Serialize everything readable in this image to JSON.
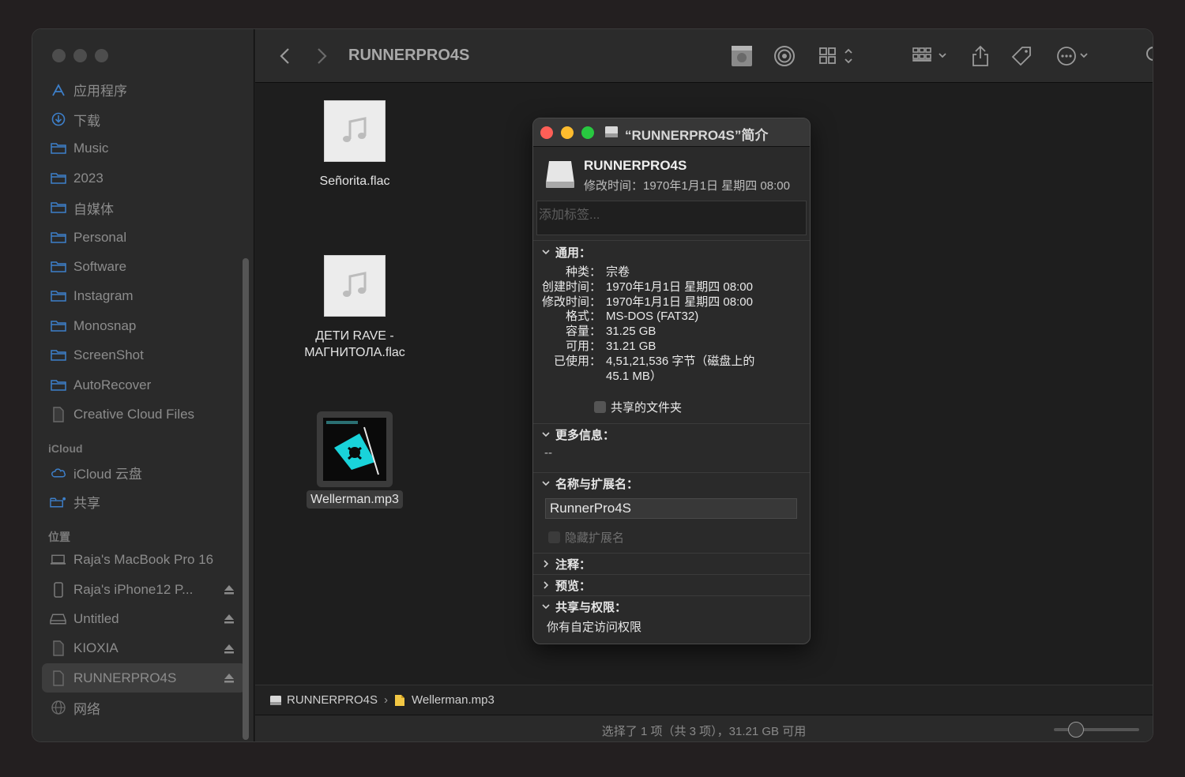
{
  "window": {
    "title": "RUNNERPRO4S"
  },
  "sidebar": {
    "favorites": [
      {
        "label": "应用程序",
        "icon": "apps-icon"
      },
      {
        "label": "下载",
        "icon": "download-icon"
      },
      {
        "label": "Music",
        "icon": "folder-icon"
      },
      {
        "label": "2023",
        "icon": "folder-icon"
      },
      {
        "label": "自媒体",
        "icon": "folder-icon"
      },
      {
        "label": "Personal",
        "icon": "folder-icon"
      },
      {
        "label": "Software",
        "icon": "folder-icon"
      },
      {
        "label": "Instagram",
        "icon": "folder-icon"
      },
      {
        "label": "Monosnap",
        "icon": "folder-icon"
      },
      {
        "label": "ScreenShot",
        "icon": "folder-icon"
      },
      {
        "label": "AutoRecover",
        "icon": "folder-icon"
      },
      {
        "label": "Creative Cloud Files",
        "icon": "document-icon"
      }
    ],
    "icloud_header": "iCloud",
    "icloud": [
      {
        "label": "iCloud 云盘",
        "icon": "cloud-icon"
      },
      {
        "label": "共享",
        "icon": "shared-folder-icon"
      }
    ],
    "locations_header": "位置",
    "locations": [
      {
        "label": "Raja's MacBook Pro 16",
        "icon": "laptop-icon",
        "eject": false
      },
      {
        "label": "Raja's iPhone12 P...",
        "icon": "phone-icon",
        "eject": true
      },
      {
        "label": "Untitled",
        "icon": "drive-icon",
        "eject": true
      },
      {
        "label": "KIOXIA",
        "icon": "document-icon",
        "eject": true
      },
      {
        "label": "RUNNERPRO4S",
        "icon": "document-icon",
        "eject": true,
        "selected": true
      },
      {
        "label": "网络",
        "icon": "globe-icon",
        "eject": false
      }
    ]
  },
  "files": [
    {
      "name": "Señorita.flac",
      "line2": ""
    },
    {
      "name": "ДЕТИ RAVE -",
      "line2": "МАГНИТОЛА.flac"
    },
    {
      "name": "Wellerman.mp3",
      "line2": "",
      "selected": true
    }
  ],
  "pathbar": {
    "items": [
      "RUNNERPRO4S",
      "Wellerman.mp3"
    ]
  },
  "statusbar": {
    "text": "选择了 1 项（共 3 项），31.21 GB 可用"
  },
  "info": {
    "title": "“RUNNERPRO4S”简介",
    "name": "RUNNERPRO4S",
    "modified": "修改时间：1970年1月1日 星期四 08:00",
    "tags_placeholder": "添加标签...",
    "general_header": "通用：",
    "general": [
      {
        "k": "种类：",
        "v": "宗卷"
      },
      {
        "k": "创建时间：",
        "v": "1970年1月1日 星期四 08:00"
      },
      {
        "k": "修改时间：",
        "v": "1970年1月1日 星期四 08:00"
      },
      {
        "k": "格式：",
        "v": "MS-DOS (FAT32)"
      },
      {
        "k": "容量：",
        "v": "31.25 GB"
      },
      {
        "k": "可用：",
        "v": "31.21 GB"
      },
      {
        "k": "已使用：",
        "v": "4,51,21,536 字节（磁盘上的"
      },
      {
        "k": "",
        "v": "45.1 MB）"
      }
    ],
    "shared_folder": "共享的文件夹",
    "more_header": "更多信息：",
    "more_value": "--",
    "name_ext_header": "名称与扩展名：",
    "name_value": "RunnerPro4S",
    "hide_ext": "隐藏扩展名",
    "comments_header": "注释：",
    "preview_header": "预览：",
    "sharing_header": "共享与权限：",
    "sharing_text": "你有自定访问权限"
  },
  "colors": {
    "close": "#fe5f57",
    "minimize": "#febc2e",
    "zoom": "#28c840",
    "accent_cyan": "#19d3da"
  }
}
